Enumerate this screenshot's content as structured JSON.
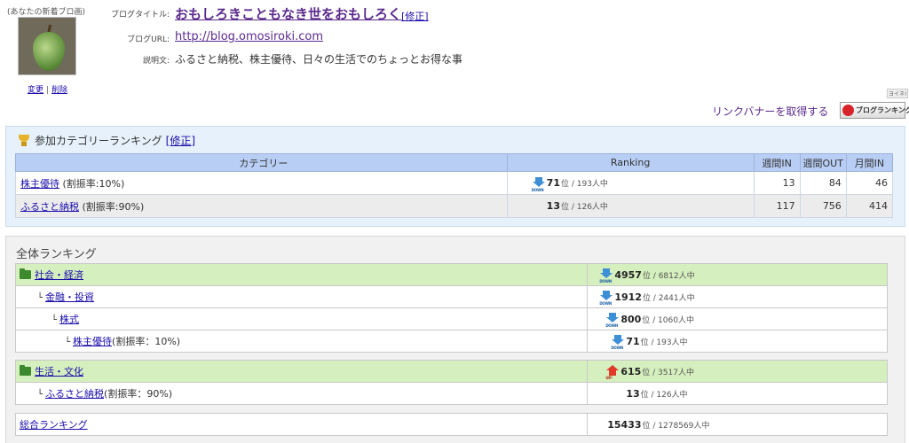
{
  "profile": {
    "thumb_caption": "(あなたの新着ブロ画)",
    "change_link": "変更",
    "separator": "|",
    "delete_link": "削除",
    "title_label": "ブログタイトル:",
    "title": "おもしろきこともなき世をおもしろく",
    "title_edit": "[修正]",
    "url_label": "ブログURL:",
    "url": "http://blog.omosiroki.com",
    "desc_label": "説明文:",
    "description": "ふるさと納税、株主優待、日々の生活でのちょっとお得な事"
  },
  "banner": {
    "badge": "ヨイネ!",
    "link_text": "リンクバナーを取得する",
    "button_label": "ブログランキング"
  },
  "category_ranking": {
    "title": "参加カテゴリーランキング",
    "edit": "[修正]",
    "headers": [
      "カテゴリー",
      "Ranking",
      "週間IN",
      "週間OUT",
      "月間IN"
    ],
    "rows": [
      {
        "name": "株主優待",
        "note": " (割振率:10%)",
        "trend": "down",
        "trend_tag": "DOWN",
        "rank": "71",
        "of": "位 / 193人中",
        "week_in": "13",
        "week_out": "84",
        "month_in": "46"
      },
      {
        "name": "ふるさと納税",
        "note": " (割振率:90%)",
        "trend": "none",
        "trend_tag": "",
        "rank": "13",
        "of": "位 / 126人中",
        "week_in": "117",
        "week_out": "756",
        "month_in": "414"
      }
    ]
  },
  "overall_ranking": {
    "title": "全体ランキング",
    "group1": {
      "head": {
        "name": "社会・経済",
        "trend": "down",
        "trend_tag": "DOWN",
        "rank": "4957",
        "of": "位 / 6812人中"
      },
      "rows": [
        {
          "branch": "└",
          "name": "金融・投資",
          "note": "",
          "trend": "down",
          "trend_tag": "DOWN",
          "rank": "1912",
          "of": "位 / 2441人中"
        },
        {
          "branch": "└",
          "name": "株式",
          "note": "",
          "trend": "down",
          "trend_tag": "DOWN",
          "rank": "800",
          "of": "位 / 1060人中"
        },
        {
          "branch": "└",
          "name": "株主優待",
          "note": "(割振率：10%)",
          "trend": "down",
          "trend_tag": "DOWN",
          "rank": "71",
          "of": "位 / 193人中"
        }
      ]
    },
    "group2": {
      "head": {
        "name": "生活・文化",
        "trend": "up",
        "trend_tag": "UP!",
        "rank": "615",
        "of": "位 / 3517人中"
      },
      "rows": [
        {
          "branch": "└",
          "name": "ふるさと納税",
          "note": "(割振率：90%)",
          "trend": "none",
          "trend_tag": "",
          "rank": "13",
          "of": "位 / 126人中"
        }
      ]
    },
    "total": {
      "name": "総合ランキング",
      "rank": "15433",
      "of": "位 / 1278569人中"
    }
  }
}
